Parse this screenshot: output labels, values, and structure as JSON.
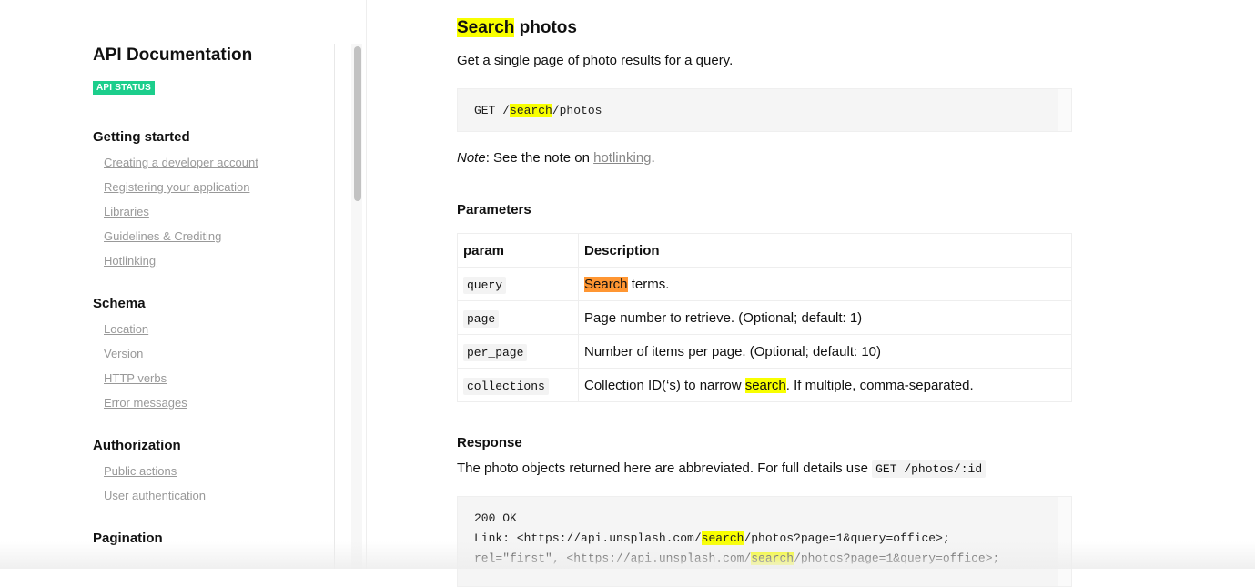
{
  "sidebar": {
    "title": "API Documentation",
    "status_badge": "API STATUS",
    "sections": [
      {
        "heading": "Getting started",
        "links": [
          "Creating a developer account",
          "Registering your application",
          "Libraries",
          "Guidelines & Crediting",
          "Hotlinking"
        ]
      },
      {
        "heading": "Schema",
        "links": [
          "Location",
          "Version",
          "HTTP verbs",
          "Error messages"
        ]
      },
      {
        "heading": "Authorization",
        "links": [
          "Public actions",
          "User authentication"
        ]
      },
      {
        "heading": "Pagination",
        "links": []
      }
    ]
  },
  "main": {
    "title_highlight": "Search",
    "title_rest": " photos",
    "intro": "Get a single page of photo results for a query.",
    "endpoint": {
      "prefix": "GET /",
      "highlight": "search",
      "suffix": "/photos"
    },
    "note": {
      "label": "Note",
      "text": ": See the note on ",
      "link": "hotlinking",
      "end": "."
    },
    "parameters_heading": "Parameters",
    "table": {
      "headers": [
        "param",
        "Description"
      ],
      "rows": [
        {
          "param": "query",
          "desc_before": "",
          "desc_highlight": "Search",
          "desc_after": " terms."
        },
        {
          "param": "page",
          "desc_before": "Page number to retrieve. (Optional; default: 1)",
          "desc_highlight": "",
          "desc_after": ""
        },
        {
          "param": "per_page",
          "desc_before": "Number of items per page. (Optional; default: 10)",
          "desc_highlight": "",
          "desc_after": ""
        },
        {
          "param": "collections",
          "desc_before": "Collection ID(‘s) to narrow ",
          "desc_highlight": "search",
          "desc_after": ". If multiple, comma-separated."
        }
      ]
    },
    "response_heading": "Response",
    "response_text": "The photo objects returned here are abbreviated. For full details use ",
    "response_code": "GET /photos/:id",
    "response_block": {
      "status": "200 OK",
      "line1_a": "Link: <https://api.unsplash.com/",
      "line1_hl": "search",
      "line1_b": "/photos?page=1&query=office>;",
      "line2_a": "rel=\"first\", <https://api.unsplash.com/",
      "line2_hl": "search",
      "line2_b": "/photos?page=1&query=office>;"
    }
  },
  "colors": {
    "highlight_yellow": "#f8ff00",
    "highlight_orange": "#ff9632",
    "badge_green": "#1cce8c",
    "link_gray": "#999999"
  }
}
